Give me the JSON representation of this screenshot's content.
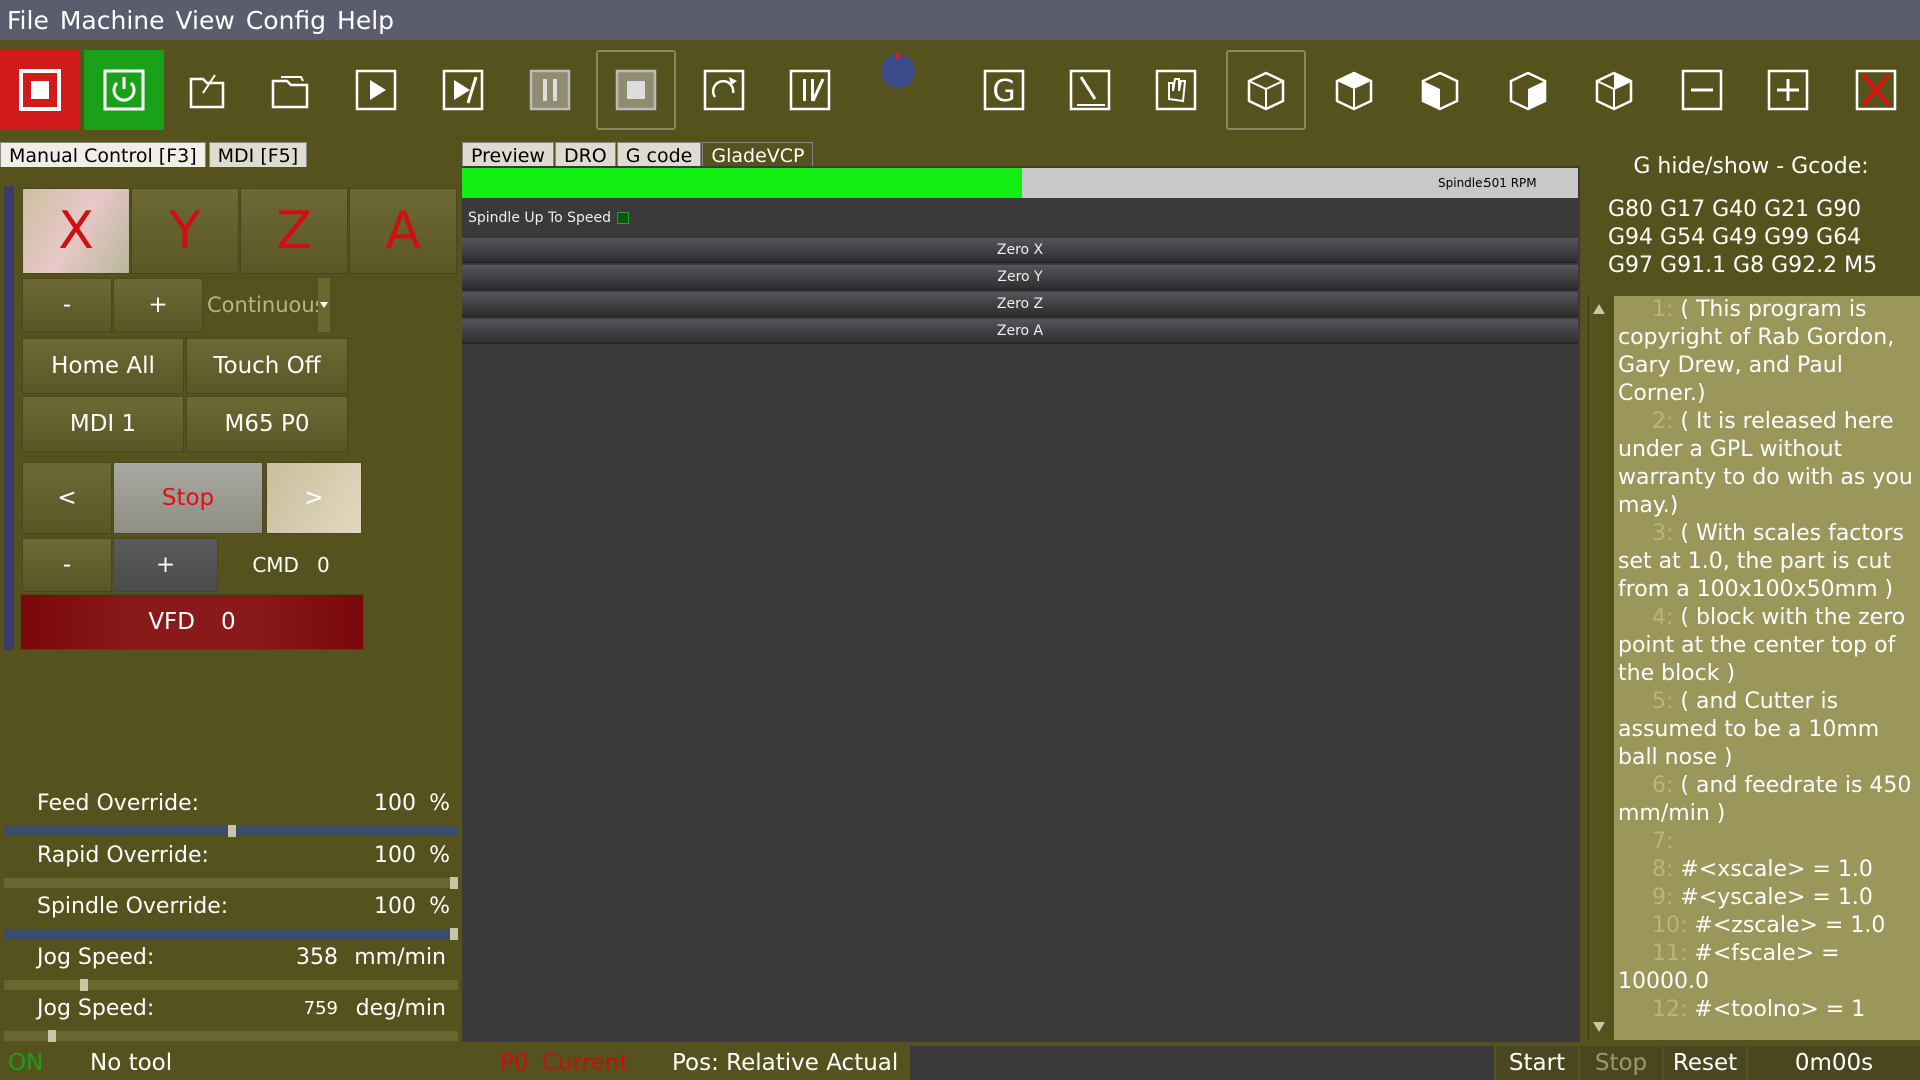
{
  "menu": [
    "File",
    "Machine",
    "View",
    "Config",
    "Help"
  ],
  "toolbar_icons": [
    "estop-icon",
    "power-icon",
    "open-file-icon",
    "reload-icon",
    "run-icon",
    "step-icon",
    "pause-icon",
    "stop-icon",
    "rerun-icon",
    "optional-stop-icon",
    "status-dot-icon",
    "g-icon",
    "touch-probe-icon",
    "jog-hand-icon",
    "view-iso-icon",
    "view-top-icon",
    "view-front-icon",
    "view-side-icon",
    "view-perspective-icon",
    "zoom-out-icon",
    "zoom-in-icon",
    "clear-icon"
  ],
  "left_tabs": {
    "manual": "Manual Control [F3]",
    "mdi": "MDI [F5]"
  },
  "axes": [
    "X",
    "Y",
    "Z",
    "A"
  ],
  "jog": {
    "minus": "-",
    "plus": "+",
    "mode": "Continuous"
  },
  "buttons": {
    "home_all": "Home All",
    "touch_off": "Touch Off",
    "mdi1": "MDI 1",
    "m65": "M65 P0",
    "prev": "<",
    "stop": "Stop",
    "next": ">",
    "minus": "-",
    "plus": "+",
    "cmd": "CMD",
    "cmd_val": "0",
    "vfd": "VFD",
    "vfd_val": "0"
  },
  "overrides": {
    "feed": {
      "label": "Feed Override:",
      "value": "100",
      "unit": "%"
    },
    "rapid": {
      "label": "Rapid Override:",
      "value": "100",
      "unit": "%"
    },
    "spindle": {
      "label": "Spindle Override:",
      "value": "100",
      "unit": "%"
    },
    "jog_lin": {
      "label": "Jog Speed:",
      "value": "358",
      "unit": "mm/min"
    },
    "jog_ang": {
      "label": "Jog Speed:",
      "value": "759",
      "unit": "deg/min"
    }
  },
  "center_tabs": [
    "Preview",
    "DRO",
    "G code",
    "GladeVCP"
  ],
  "spindle": {
    "label": "Spindle:",
    "value": "501 RPM",
    "up_to_speed": "Spindle Up To Speed"
  },
  "zero_buttons": [
    "Zero X",
    "Zero Y",
    "Zero Z",
    "Zero A"
  ],
  "gcode_panel": {
    "title": "G hide/show - Gcode:",
    "active_codes": [
      "G80 G17 G40 G21 G90",
      "G94 G54 G49 G99 G64",
      "G97 G91.1 G8 G92.2 M5"
    ],
    "lines": [
      {
        "n": "1:",
        "t": "( This program is copyright of Rab Gordon, Gary Drew, and Paul Corner.)"
      },
      {
        "n": "2:",
        "t": "( It is released here under a GPL without warranty to do with as you may.)"
      },
      {
        "n": "3:",
        "t": "( With scales factors set at 1.0, the part is cut from a 100x100x50mm )"
      },
      {
        "n": "4:",
        "t": "( block with the zero point at the center top of the block )"
      },
      {
        "n": "5:",
        "t": "( and Cutter is assumed to be a 10mm ball nose )"
      },
      {
        "n": "6:",
        "t": "( and feedrate is 450 mm/min )"
      },
      {
        "n": "7:",
        "t": ""
      },
      {
        "n": "8:",
        "t": "#<xscale> = 1.0"
      },
      {
        "n": "9:",
        "t": "#<yscale> = 1.0"
      },
      {
        "n": "10:",
        "t": "#<zscale> = 1.0"
      },
      {
        "n": "11:",
        "t": "#<fscale> = 10000.0"
      },
      {
        "n": "12:",
        "t": "#<toolno> = 1"
      }
    ]
  },
  "status": {
    "on": "ON",
    "tool": "No tool",
    "p0": "P0",
    "current": "Current",
    "pos": "Pos: Relative Actual",
    "start": "Start",
    "stop": "Stop",
    "reset": "Reset",
    "time": "0m00s"
  },
  "colors": {
    "background": "#56521e",
    "menubar": "#5b5d6e",
    "spindle_green": "#11ee11",
    "axis_red": "#d01010"
  }
}
